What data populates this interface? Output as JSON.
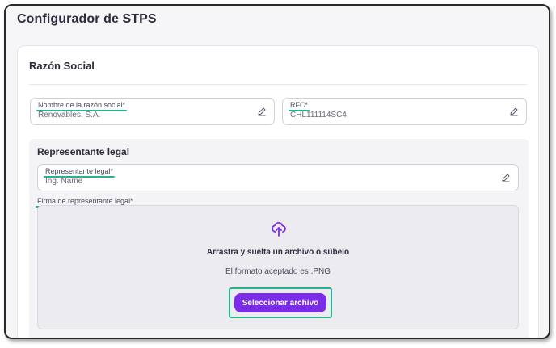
{
  "page": {
    "title": "Configurador de STPS"
  },
  "razon_social": {
    "title": "Razón Social",
    "nombre": {
      "label": "Nombre de la razón social*",
      "value": "Renovables, S.A."
    },
    "rfc": {
      "label": "RFC*",
      "value": "CHL111114SC4"
    }
  },
  "representante": {
    "title": "Representante legal",
    "field": {
      "label": "Representante legal*",
      "value": "Ing. Name"
    },
    "firma": {
      "label": "Firma de representante legal*",
      "dropzone_title": "Arrastra y suelta un archivo o súbelo",
      "format_text": "El formato aceptado es .PNG",
      "button_label": "Seleccionar archivo"
    }
  },
  "colors": {
    "accent": "#7a2ce6",
    "highlight": "#25b58c"
  },
  "icons": {
    "edit": "edit-pencil-icon",
    "upload": "upload-cloud-icon"
  }
}
